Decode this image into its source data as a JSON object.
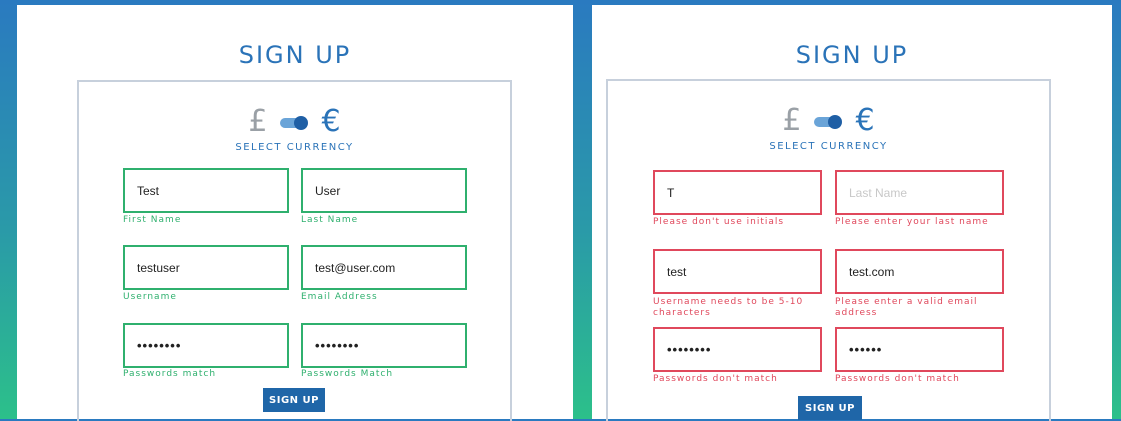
{
  "colors": {
    "background_top": "#2a7ac0",
    "background_bottom": "#2cc08a",
    "title": "#2a73b8",
    "valid": "#2fb06e",
    "invalid": "#e0485c",
    "button": "#1f66a8"
  },
  "left": {
    "title": "SIGN UP",
    "currency": {
      "gbp": "£",
      "eur": "€",
      "label": "SELECT CURRENCY",
      "selected": "eur"
    },
    "first_name": {
      "value": "Test",
      "helper": "First Name"
    },
    "last_name": {
      "value": "User",
      "helper": "Last Name"
    },
    "username": {
      "value": "testuser",
      "helper": "Username"
    },
    "email": {
      "value": "test@user.com",
      "helper": "Email Address"
    },
    "password": {
      "value": "••••••••",
      "helper": "Passwords match"
    },
    "confirm_password": {
      "value": "••••••••",
      "helper": "Passwords Match"
    },
    "submit": "SIGN UP"
  },
  "right": {
    "title": "SIGN UP",
    "currency": {
      "gbp": "£",
      "eur": "€",
      "label": "SELECT CURRENCY",
      "selected": "eur"
    },
    "first_name": {
      "value": "T",
      "helper": "Please don't use initials"
    },
    "last_name": {
      "placeholder": "Last Name",
      "helper": "Please enter your last name"
    },
    "username": {
      "value": "test",
      "helper": "Username needs to be 5-10 characters"
    },
    "email": {
      "value": "test.com",
      "helper": "Please enter a valid email address"
    },
    "password": {
      "value": "••••••••",
      "helper": "Passwords don't match"
    },
    "confirm_password": {
      "value": "••••••",
      "helper": "Passwords don't match"
    },
    "submit": "SIGN UP"
  }
}
